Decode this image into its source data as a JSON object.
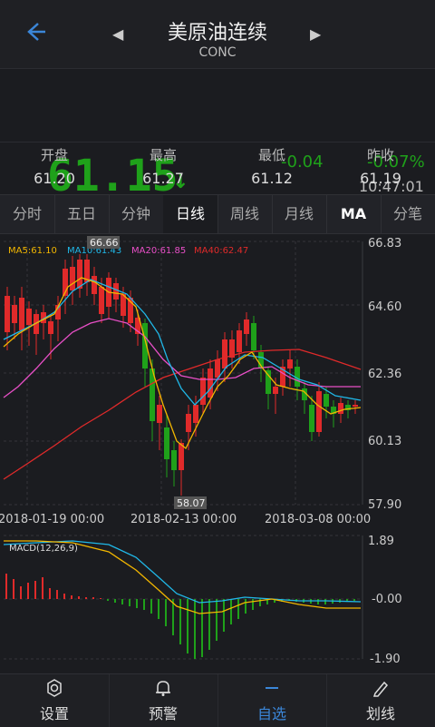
{
  "header": {
    "title": "美原油连续",
    "code": "CONC",
    "back_icon": "back-arrow-icon",
    "prev_icon": "prev-icon",
    "next_icon": "next-icon"
  },
  "quote": {
    "price": "61.15",
    "change": "-0.04",
    "change_pct": "-0.07%",
    "time": "10:47:01",
    "color": "#1fa11a"
  },
  "stats": [
    {
      "label": "开盘",
      "value": "61.20"
    },
    {
      "label": "最高",
      "value": "61.27"
    },
    {
      "label": "最低",
      "value": "61.12"
    },
    {
      "label": "昨收",
      "value": "61.19"
    }
  ],
  "tabs": [
    "分时",
    "五日",
    "分钟",
    "日线",
    "周线",
    "月线",
    "MA",
    "分笔"
  ],
  "active_tab": "日线",
  "chart": {
    "legend": [
      {
        "label": "MA5:61.10",
        "color": "#f2b600"
      },
      {
        "label": "MA10:61.43",
        "color": "#20b8e8"
      },
      {
        "label": "MA20:61.85",
        "color": "#e84fc7"
      },
      {
        "label": "MA40:62.47",
        "color": "#e02a2a"
      }
    ],
    "y_ticks": [
      "66.83",
      "64.60",
      "62.36",
      "60.13",
      "57.90"
    ],
    "x_ticks": [
      "2018-01-19 00:00",
      "2018-02-13 00:00",
      "2018-03-08 00:00"
    ],
    "high_label": "66.66",
    "low_label": "58.07",
    "macd_label": "MACD(12,26,9)",
    "macd_ticks": [
      "1.89",
      "-0.00",
      "-1.90"
    ]
  },
  "nav": [
    {
      "icon": "settings-icon",
      "label": "设置"
    },
    {
      "icon": "bell-icon",
      "label": "预警"
    },
    {
      "icon": "minus-icon",
      "label": "自选"
    },
    {
      "icon": "pen-icon",
      "label": "划线"
    }
  ],
  "colors": {
    "up": "#e02a2a",
    "down": "#1fa11a",
    "accent": "#3b86d8"
  }
}
